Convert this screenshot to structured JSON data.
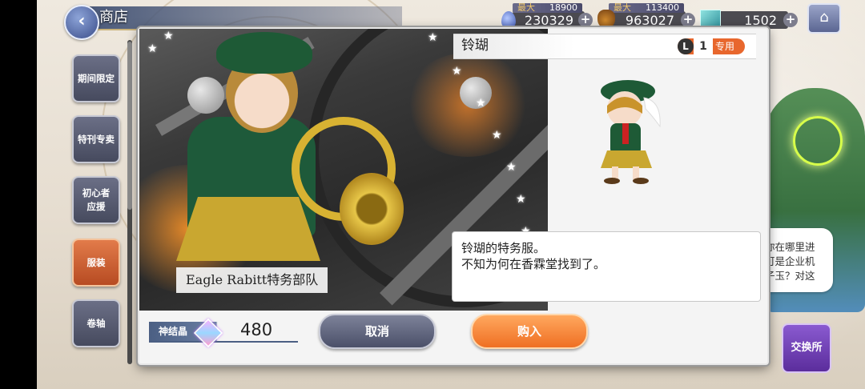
{
  "header": {
    "title": "商店",
    "currencies": [
      {
        "cap_label": "最大",
        "cap_value": "18900",
        "value": "230329"
      },
      {
        "cap_label": "最大",
        "cap_value": "113400",
        "value": "963027"
      },
      {
        "value": "1502"
      }
    ]
  },
  "sidebar": {
    "tabs": [
      {
        "label": "期间限定"
      },
      {
        "label": "特刊专卖"
      },
      {
        "label": "初心者\n应援"
      },
      {
        "label": "服装",
        "active": true
      },
      {
        "label": "卷轴"
      }
    ]
  },
  "npc": {
    "text": "你在哪里进\n可是企业机\n子玉？对这"
  },
  "exchange_label": "交换所",
  "item": {
    "art_caption": "Eagle Rabitt特务部队",
    "name": "铃瑚",
    "level_prefix": "L",
    "level": "1",
    "level_tag": "专用",
    "description": "铃瑚的特务服。\n不知为何在香霖堂找到了。"
  },
  "purchase": {
    "currency_label": "神结晶",
    "price": "480",
    "cancel_label": "取消",
    "buy_label": "购入"
  },
  "colors": {
    "accent_orange": "#ef6f23",
    "cancel_gray": "#4b5069",
    "active_tab": "#e27b4a"
  }
}
